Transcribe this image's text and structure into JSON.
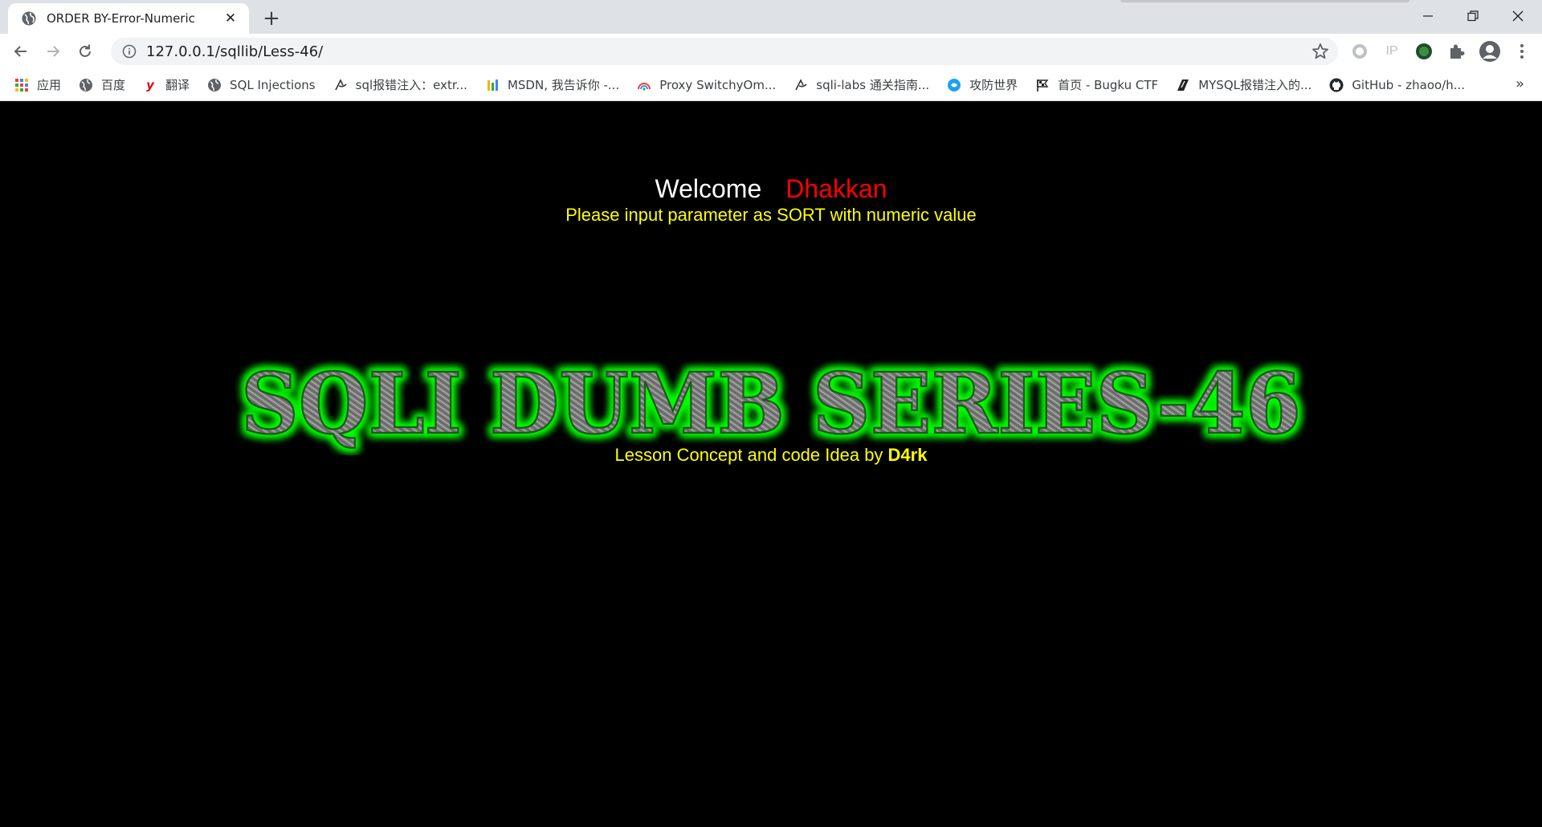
{
  "tab": {
    "title": "ORDER BY-Error-Numeric",
    "favicon": "globe-icon"
  },
  "toolbar": {
    "url": "127.0.0.1/sqllib/Less-46/"
  },
  "bookmarks": [
    {
      "label": "应用",
      "icon": "apps-grid-icon"
    },
    {
      "label": "百度",
      "icon": "globe-icon"
    },
    {
      "label": "翻译",
      "icon": "youdao-icon"
    },
    {
      "label": "SQL Injections",
      "icon": "globe-icon"
    },
    {
      "label": "sql报错注入：extr...",
      "icon": "csdn-icon"
    },
    {
      "label": "MSDN, 我告诉你 -...",
      "icon": "msdn-icon"
    },
    {
      "label": "Proxy SwitchyOm...",
      "icon": "switchy-icon"
    },
    {
      "label": "sqli-labs 通关指南...",
      "icon": "csdn-icon"
    },
    {
      "label": "攻防世界",
      "icon": "adworld-icon"
    },
    {
      "label": "首页 - Bugku CTF",
      "icon": "flag-icon"
    },
    {
      "label": "MYSQL报错注入的...",
      "icon": "bookmark-icon"
    },
    {
      "label": "GitHub - zhaoo/h...",
      "icon": "github-icon"
    }
  ],
  "page": {
    "welcome": "Welcome",
    "name": "Dhakkan",
    "instruction": "Please input parameter as SORT with numeric value",
    "banner": "SQLI DUMB SERIES-46",
    "credit_prefix": "Lesson Concept and code Idea by ",
    "credit_author": "D4rk"
  },
  "colors": {
    "welcome": "#ffffff",
    "name": "#ff0000",
    "instruction": "#ffff00",
    "banner_glow": "#00ff00"
  }
}
